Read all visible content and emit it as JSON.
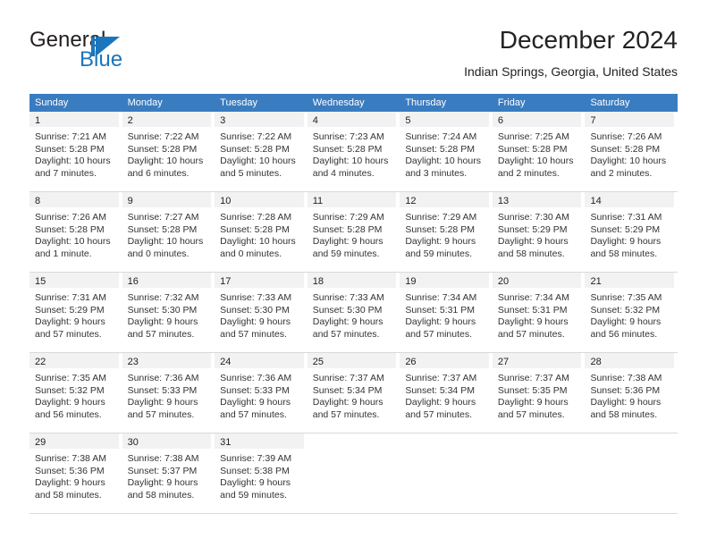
{
  "brand": {
    "name_part1": "General",
    "name_part2": "Blue",
    "accent_color": "#1b75bc"
  },
  "header": {
    "month_title": "December 2024",
    "location": "Indian Springs, Georgia, United States"
  },
  "calendar": {
    "header_bg": "#3a7cc0",
    "weekdays": [
      "Sunday",
      "Monday",
      "Tuesday",
      "Wednesday",
      "Thursday",
      "Friday",
      "Saturday"
    ],
    "weeks": [
      [
        {
          "day": "1",
          "sunrise": "Sunrise: 7:21 AM",
          "sunset": "Sunset: 5:28 PM",
          "daylight1": "Daylight: 10 hours",
          "daylight2": "and 7 minutes."
        },
        {
          "day": "2",
          "sunrise": "Sunrise: 7:22 AM",
          "sunset": "Sunset: 5:28 PM",
          "daylight1": "Daylight: 10 hours",
          "daylight2": "and 6 minutes."
        },
        {
          "day": "3",
          "sunrise": "Sunrise: 7:22 AM",
          "sunset": "Sunset: 5:28 PM",
          "daylight1": "Daylight: 10 hours",
          "daylight2": "and 5 minutes."
        },
        {
          "day": "4",
          "sunrise": "Sunrise: 7:23 AM",
          "sunset": "Sunset: 5:28 PM",
          "daylight1": "Daylight: 10 hours",
          "daylight2": "and 4 minutes."
        },
        {
          "day": "5",
          "sunrise": "Sunrise: 7:24 AM",
          "sunset": "Sunset: 5:28 PM",
          "daylight1": "Daylight: 10 hours",
          "daylight2": "and 3 minutes."
        },
        {
          "day": "6",
          "sunrise": "Sunrise: 7:25 AM",
          "sunset": "Sunset: 5:28 PM",
          "daylight1": "Daylight: 10 hours",
          "daylight2": "and 2 minutes."
        },
        {
          "day": "7",
          "sunrise": "Sunrise: 7:26 AM",
          "sunset": "Sunset: 5:28 PM",
          "daylight1": "Daylight: 10 hours",
          "daylight2": "and 2 minutes."
        }
      ],
      [
        {
          "day": "8",
          "sunrise": "Sunrise: 7:26 AM",
          "sunset": "Sunset: 5:28 PM",
          "daylight1": "Daylight: 10 hours",
          "daylight2": "and 1 minute."
        },
        {
          "day": "9",
          "sunrise": "Sunrise: 7:27 AM",
          "sunset": "Sunset: 5:28 PM",
          "daylight1": "Daylight: 10 hours",
          "daylight2": "and 0 minutes."
        },
        {
          "day": "10",
          "sunrise": "Sunrise: 7:28 AM",
          "sunset": "Sunset: 5:28 PM",
          "daylight1": "Daylight: 10 hours",
          "daylight2": "and 0 minutes."
        },
        {
          "day": "11",
          "sunrise": "Sunrise: 7:29 AM",
          "sunset": "Sunset: 5:28 PM",
          "daylight1": "Daylight: 9 hours",
          "daylight2": "and 59 minutes."
        },
        {
          "day": "12",
          "sunrise": "Sunrise: 7:29 AM",
          "sunset": "Sunset: 5:28 PM",
          "daylight1": "Daylight: 9 hours",
          "daylight2": "and 59 minutes."
        },
        {
          "day": "13",
          "sunrise": "Sunrise: 7:30 AM",
          "sunset": "Sunset: 5:29 PM",
          "daylight1": "Daylight: 9 hours",
          "daylight2": "and 58 minutes."
        },
        {
          "day": "14",
          "sunrise": "Sunrise: 7:31 AM",
          "sunset": "Sunset: 5:29 PM",
          "daylight1": "Daylight: 9 hours",
          "daylight2": "and 58 minutes."
        }
      ],
      [
        {
          "day": "15",
          "sunrise": "Sunrise: 7:31 AM",
          "sunset": "Sunset: 5:29 PM",
          "daylight1": "Daylight: 9 hours",
          "daylight2": "and 57 minutes."
        },
        {
          "day": "16",
          "sunrise": "Sunrise: 7:32 AM",
          "sunset": "Sunset: 5:30 PM",
          "daylight1": "Daylight: 9 hours",
          "daylight2": "and 57 minutes."
        },
        {
          "day": "17",
          "sunrise": "Sunrise: 7:33 AM",
          "sunset": "Sunset: 5:30 PM",
          "daylight1": "Daylight: 9 hours",
          "daylight2": "and 57 minutes."
        },
        {
          "day": "18",
          "sunrise": "Sunrise: 7:33 AM",
          "sunset": "Sunset: 5:30 PM",
          "daylight1": "Daylight: 9 hours",
          "daylight2": "and 57 minutes."
        },
        {
          "day": "19",
          "sunrise": "Sunrise: 7:34 AM",
          "sunset": "Sunset: 5:31 PM",
          "daylight1": "Daylight: 9 hours",
          "daylight2": "and 57 minutes."
        },
        {
          "day": "20",
          "sunrise": "Sunrise: 7:34 AM",
          "sunset": "Sunset: 5:31 PM",
          "daylight1": "Daylight: 9 hours",
          "daylight2": "and 57 minutes."
        },
        {
          "day": "21",
          "sunrise": "Sunrise: 7:35 AM",
          "sunset": "Sunset: 5:32 PM",
          "daylight1": "Daylight: 9 hours",
          "daylight2": "and 56 minutes."
        }
      ],
      [
        {
          "day": "22",
          "sunrise": "Sunrise: 7:35 AM",
          "sunset": "Sunset: 5:32 PM",
          "daylight1": "Daylight: 9 hours",
          "daylight2": "and 56 minutes."
        },
        {
          "day": "23",
          "sunrise": "Sunrise: 7:36 AM",
          "sunset": "Sunset: 5:33 PM",
          "daylight1": "Daylight: 9 hours",
          "daylight2": "and 57 minutes."
        },
        {
          "day": "24",
          "sunrise": "Sunrise: 7:36 AM",
          "sunset": "Sunset: 5:33 PM",
          "daylight1": "Daylight: 9 hours",
          "daylight2": "and 57 minutes."
        },
        {
          "day": "25",
          "sunrise": "Sunrise: 7:37 AM",
          "sunset": "Sunset: 5:34 PM",
          "daylight1": "Daylight: 9 hours",
          "daylight2": "and 57 minutes."
        },
        {
          "day": "26",
          "sunrise": "Sunrise: 7:37 AM",
          "sunset": "Sunset: 5:34 PM",
          "daylight1": "Daylight: 9 hours",
          "daylight2": "and 57 minutes."
        },
        {
          "day": "27",
          "sunrise": "Sunrise: 7:37 AM",
          "sunset": "Sunset: 5:35 PM",
          "daylight1": "Daylight: 9 hours",
          "daylight2": "and 57 minutes."
        },
        {
          "day": "28",
          "sunrise": "Sunrise: 7:38 AM",
          "sunset": "Sunset: 5:36 PM",
          "daylight1": "Daylight: 9 hours",
          "daylight2": "and 58 minutes."
        }
      ],
      [
        {
          "day": "29",
          "sunrise": "Sunrise: 7:38 AM",
          "sunset": "Sunset: 5:36 PM",
          "daylight1": "Daylight: 9 hours",
          "daylight2": "and 58 minutes."
        },
        {
          "day": "30",
          "sunrise": "Sunrise: 7:38 AM",
          "sunset": "Sunset: 5:37 PM",
          "daylight1": "Daylight: 9 hours",
          "daylight2": "and 58 minutes."
        },
        {
          "day": "31",
          "sunrise": "Sunrise: 7:39 AM",
          "sunset": "Sunset: 5:38 PM",
          "daylight1": "Daylight: 9 hours",
          "daylight2": "and 59 minutes."
        },
        {
          "day": "",
          "sunrise": "",
          "sunset": "",
          "daylight1": "",
          "daylight2": ""
        },
        {
          "day": "",
          "sunrise": "",
          "sunset": "",
          "daylight1": "",
          "daylight2": ""
        },
        {
          "day": "",
          "sunrise": "",
          "sunset": "",
          "daylight1": "",
          "daylight2": ""
        },
        {
          "day": "",
          "sunrise": "",
          "sunset": "",
          "daylight1": "",
          "daylight2": ""
        }
      ]
    ]
  }
}
